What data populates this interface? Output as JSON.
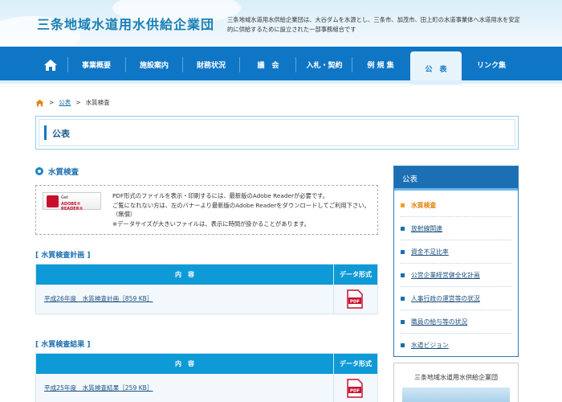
{
  "header": {
    "site_title": "三条地域水道用水供給企業団",
    "description": "三条地域水道用水供給企業団は、大谷ダムを水源とし、三条市、加茂市、田上町の水道事業体へ水道用水を安定的に供給するために設立された一部事務組合です"
  },
  "nav": {
    "home_icon": "home-icon",
    "items": [
      {
        "label": "事業概要"
      },
      {
        "label": "施設案内"
      },
      {
        "label": "財務状況"
      },
      {
        "label": "議　会"
      },
      {
        "label": "入札・契約"
      },
      {
        "label": "例 規 集"
      },
      {
        "label": "公　表"
      },
      {
        "label": "リンク集"
      }
    ],
    "active_index": 6
  },
  "breadcrumb": {
    "items": [
      "公表",
      "水質検査"
    ],
    "separator": ">"
  },
  "page": {
    "title": "公表",
    "section_title": "水質検査"
  },
  "adobe": {
    "badge_line1": "Get",
    "badge_line2": "ADOBE® READER®",
    "line1": "PDF形式のファイルを表示・印刷するには、最新版のAdobe Readerが必要です。",
    "line2": "ご覧になれない方は、左のバナーより最新版のAdobe Readerをダウンロードしてご利用下さい。（無償）",
    "line3": "※データサイズが大きいファイルは、表示に時間が掛かることがあります。"
  },
  "plan": {
    "heading": "[ 水質検査計画 ]",
    "col_content": "内　容",
    "col_format": "データ形式",
    "rows": [
      {
        "title": "平成26年度　水質検査計画［859 KB］",
        "format_icon": "pdf-icon"
      }
    ]
  },
  "results": {
    "heading": "[ 水質検査結果 ]",
    "col_content": "内　容",
    "col_format": "データ形式",
    "rows": [
      {
        "title": "平成25年度　水質検査結果［259 KB］",
        "format_icon": "pdf-icon"
      }
    ]
  },
  "sidebar": {
    "title": "公表",
    "items": [
      {
        "label": "水質検査",
        "active": true
      },
      {
        "label": "放射線関連"
      },
      {
        "label": "資金不足比率"
      },
      {
        "label": "公営企業経営健全化計画"
      },
      {
        "label": "人事行政の運営等の状況"
      },
      {
        "label": "職員の給与等の状況"
      },
      {
        "label": "水道ビジョン"
      }
    ]
  },
  "banner": {
    "title": "三条地域水道用水供給企業団"
  },
  "colors": {
    "nav_blue": "#0f76c6",
    "table_head": "#0e9ad6",
    "active_orange": "#e0850f"
  }
}
